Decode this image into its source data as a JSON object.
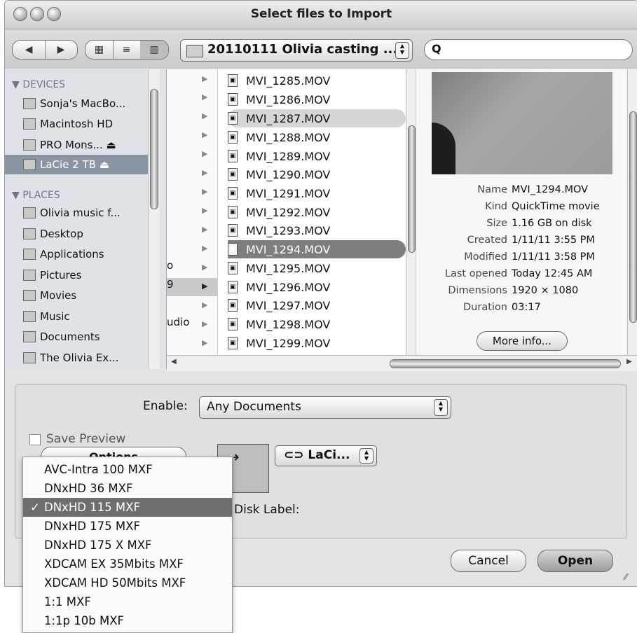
{
  "window": {
    "title": "Select files to Import"
  },
  "toolbar": {
    "path_label": "20110111 Olivia casting ...",
    "search_placeholder": ""
  },
  "sidebar": {
    "devices_header": "▼ DEVICES",
    "devices": [
      {
        "label": "Sonja's MacBo..."
      },
      {
        "label": "Macintosh HD"
      },
      {
        "label": "PRO Mons...  ⏏"
      },
      {
        "label": "LaCie 2 TB  ⏏"
      }
    ],
    "places_header": "▼ PLACES",
    "places": [
      {
        "label": "Olivia music f..."
      },
      {
        "label": "Desktop"
      },
      {
        "label": "Applications"
      },
      {
        "label": "Pictures"
      },
      {
        "label": "Movies"
      },
      {
        "label": "Music"
      },
      {
        "label": "Documents"
      },
      {
        "label": "The Olivia Ex..."
      }
    ]
  },
  "column1": {
    "rows": [
      {
        "text": ""
      },
      {
        "text": ""
      },
      {
        "text": ""
      },
      {
        "text": ""
      },
      {
        "text": ""
      },
      {
        "text": ""
      },
      {
        "text": ""
      },
      {
        "text": ""
      },
      {
        "text": ""
      },
      {
        "text": ""
      },
      {
        "text": "o"
      },
      {
        "text": "9"
      },
      {
        "text": ""
      },
      {
        "text": "udio"
      },
      {
        "text": ""
      }
    ]
  },
  "files": {
    "items": [
      {
        "name": "MVI_1285.MOV"
      },
      {
        "name": "MVI_1286.MOV"
      },
      {
        "name": "MVI_1287.MOV"
      },
      {
        "name": "MVI_1288.MOV"
      },
      {
        "name": "MVI_1289.MOV"
      },
      {
        "name": "MVI_1290.MOV"
      },
      {
        "name": "MVI_1291.MOV"
      },
      {
        "name": "MVI_1292.MOV"
      },
      {
        "name": "MVI_1293.MOV"
      },
      {
        "name": "MVI_1294.MOV"
      },
      {
        "name": "MVI_1295.MOV"
      },
      {
        "name": "MVI_1296.MOV"
      },
      {
        "name": "MVI_1297.MOV"
      },
      {
        "name": "MVI_1298.MOV"
      },
      {
        "name": "MVI_1299.MOV"
      }
    ]
  },
  "preview": {
    "info": [
      {
        "key": "Name",
        "value": "MVI_1294.MOV"
      },
      {
        "key": "Kind",
        "value": "QuickTime movie"
      },
      {
        "key": "Size",
        "value": "1.16 GB on disk"
      },
      {
        "key": "Created",
        "value": "1/11/11 3:55 PM"
      },
      {
        "key": "Modified",
        "value": "1/11/11 3:58 PM"
      },
      {
        "key": "Last opened",
        "value": "Today 12:45 AM"
      },
      {
        "key": "Dimensions",
        "value": "1920 × 1080"
      },
      {
        "key": "Duration",
        "value": "03:17"
      }
    ],
    "more_info_label": "More info..."
  },
  "options": {
    "enable_label": "Enable:",
    "enable_value": "Any Documents",
    "save_preview_label": "Save Preview",
    "options_button_label": "Options",
    "volume_value": "LaCi...",
    "disk_label": "Disk Label:",
    "cancel_label": "Cancel",
    "open_label": "Open"
  },
  "format_menu": {
    "items": [
      {
        "label": "AVC-Intra 100  MXF",
        "check": ""
      },
      {
        "label": "DNxHD 36  MXF",
        "check": ""
      },
      {
        "label": "DNxHD 115  MXF",
        "check": "✓"
      },
      {
        "label": "DNxHD 175  MXF",
        "check": ""
      },
      {
        "label": "DNxHD 175 X  MXF",
        "check": ""
      },
      {
        "label": "XDCAM EX 35Mbits  MXF",
        "check": ""
      },
      {
        "label": "XDCAM HD 50Mbits  MXF",
        "check": ""
      },
      {
        "label": "1:1  MXF",
        "check": ""
      },
      {
        "label": "1:1p 10b  MXF",
        "check": ""
      }
    ]
  }
}
